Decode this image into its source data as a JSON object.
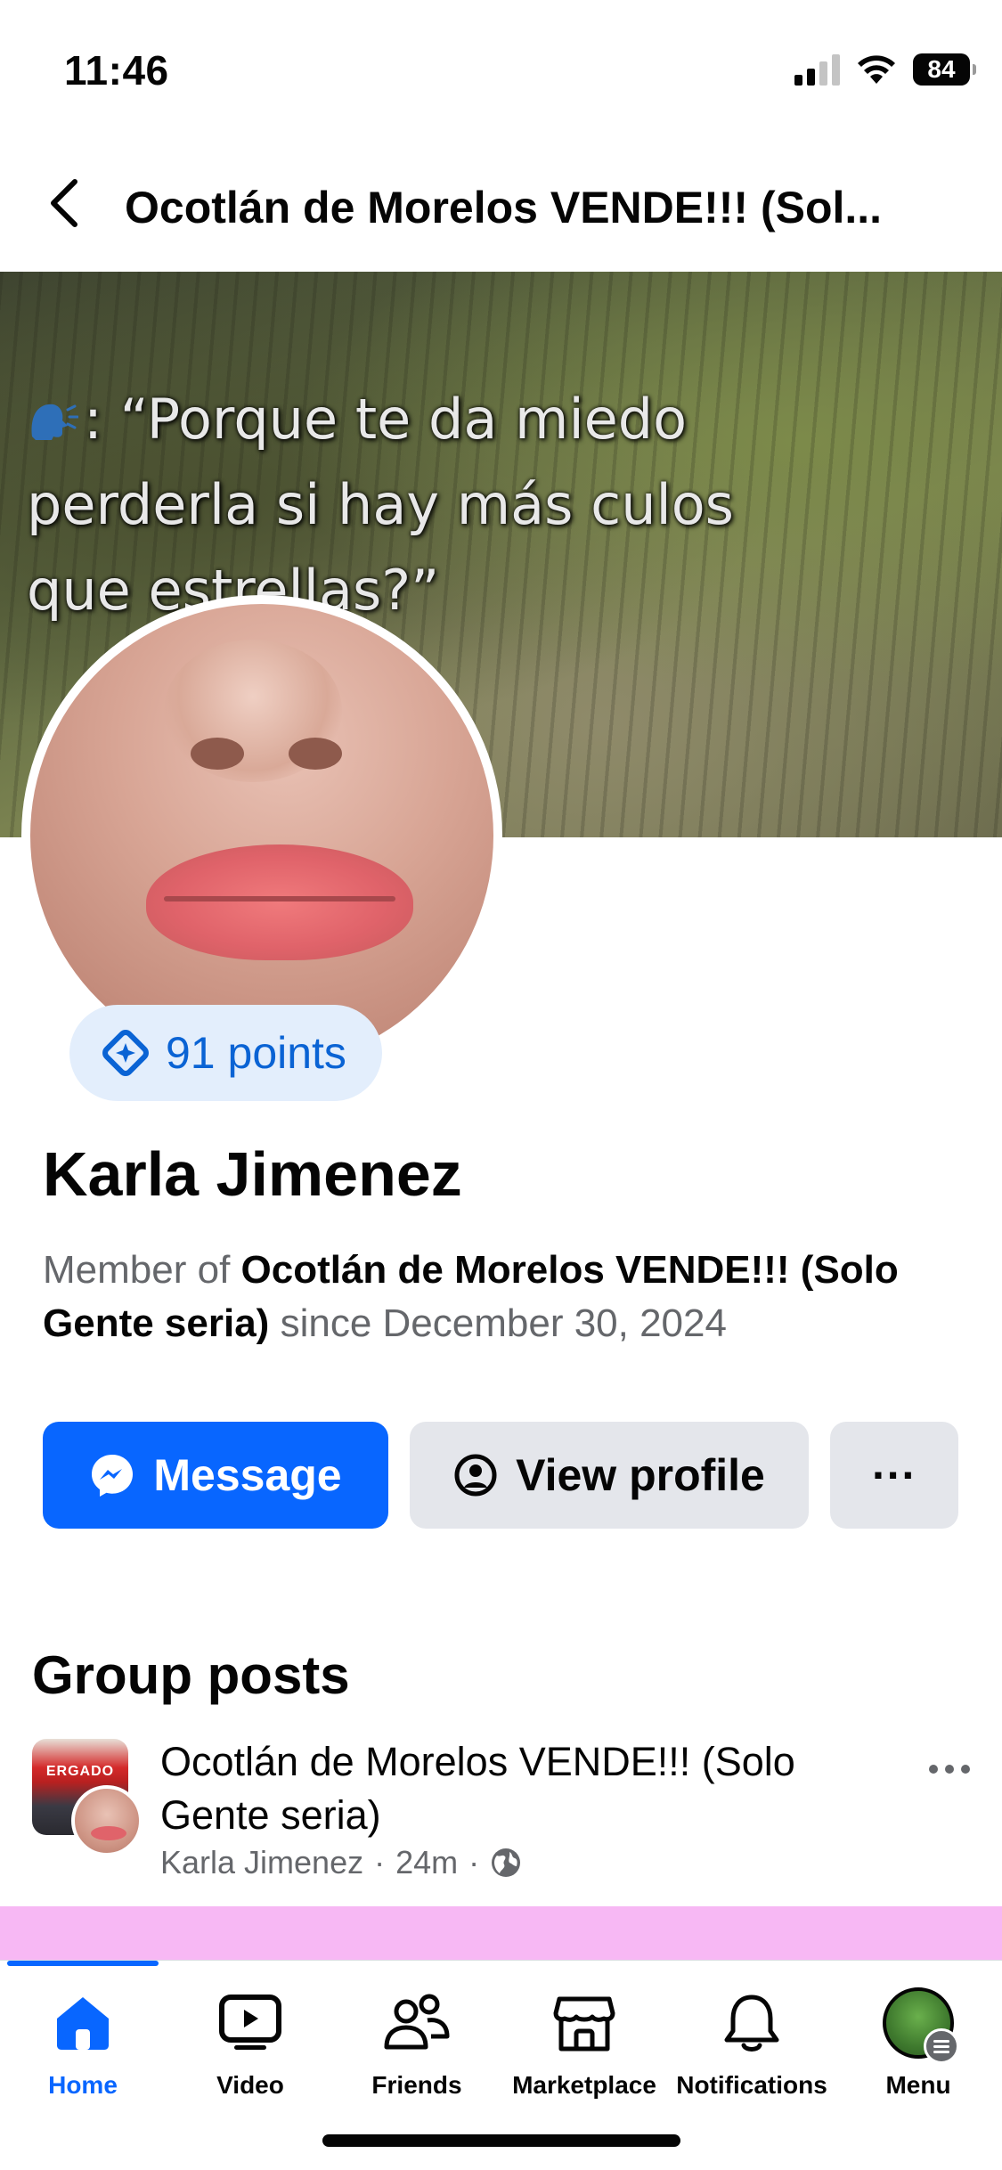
{
  "status_bar": {
    "time": "11:46",
    "battery": "84"
  },
  "header": {
    "back_icon": "chevron-left-icon",
    "title": "Ocotlán de Morelos VENDE!!! (Sol..."
  },
  "cover": {
    "caption_line1": ": “Porque te da miedo",
    "caption_line2": "perderla si hay más culos",
    "caption_line3": "que estrellas?”",
    "speaker_icon": "speaking-head-icon"
  },
  "profile": {
    "points_label": "91 points",
    "name": "Karla Jimenez",
    "membership_prefix": "Member of ",
    "group_name": "Ocotlán de Morelos VENDE!!! (Solo Gente seria)",
    "membership_suffix": " since December 30, 2024"
  },
  "actions": {
    "message_label": "Message",
    "view_profile_label": "View profile",
    "more_label": "···"
  },
  "group_posts": {
    "section_title": "Group posts",
    "posts": [
      {
        "group": "Ocotlán de Morelos VENDE!!! (Solo Gente seria)",
        "author": "Karla Jimenez",
        "time": "24m",
        "separator": "·",
        "thumb_text": "ERGADO",
        "privacy_icon": "globe-icon"
      }
    ]
  },
  "tab_bar": {
    "tabs": [
      {
        "label": "Home",
        "icon": "home-icon",
        "active": true
      },
      {
        "label": "Video",
        "icon": "video-icon",
        "active": false
      },
      {
        "label": "Friends",
        "icon": "friends-icon",
        "active": false
      },
      {
        "label": "Marketplace",
        "icon": "marketplace-icon",
        "active": false
      },
      {
        "label": "Notifications",
        "icon": "bell-icon",
        "active": false
      },
      {
        "label": "Menu",
        "icon": "menu-avatar",
        "active": false
      }
    ]
  },
  "colors": {
    "brand_blue": "#0866ff",
    "points_bg": "#e3eefc",
    "secondary_button": "#e4e6eb",
    "muted_text": "#65676b",
    "pink_band": "#f7b8f4"
  }
}
